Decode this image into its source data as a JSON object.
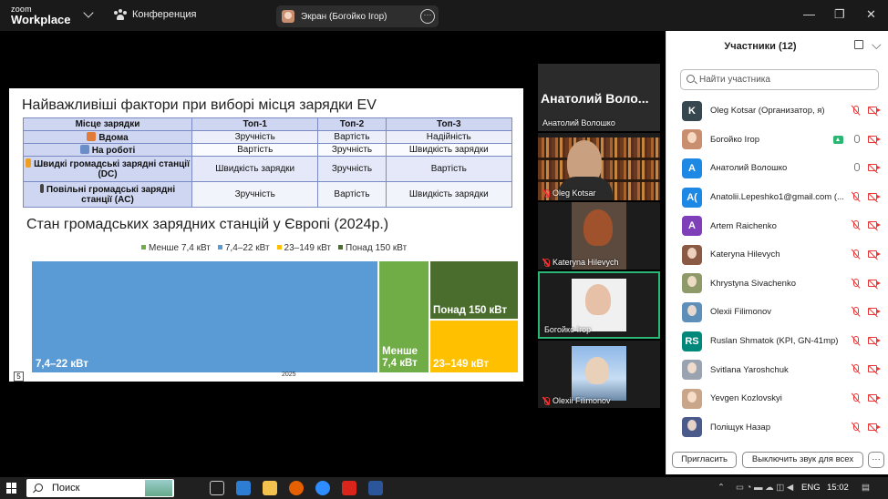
{
  "topbar": {
    "logo_line1": "zoom",
    "logo_line2": "Workplace",
    "conference_label": "Конференция",
    "share_label": "Экран (Богойко Ігор)",
    "win_min": "—",
    "win_max": "❐",
    "win_close": "✕"
  },
  "slide": {
    "title": "Найважливіші фактори при виборі місця зарядки EV",
    "table": {
      "headers": [
        "Місце зарядки",
        "Топ-1",
        "Топ-2",
        "Топ-3"
      ],
      "rows": [
        {
          "place": "Вдома",
          "top1": "Зручність",
          "top2": "Вартість",
          "top3": "Надійність"
        },
        {
          "place": "На роботі",
          "top1": "Вартість",
          "top2": "Зручність",
          "top3": "Швидкість зарядки"
        },
        {
          "place": "Швидкі громадські зарядні станції (DC)",
          "top1": "Швидкість зарядки",
          "top2": "Зручність",
          "top3": "Вартість"
        },
        {
          "place": "Повільні громадські зарядні станції (AC)",
          "top1": "Зручність",
          "top2": "Вартість",
          "top3": "Швидкість зарядки"
        }
      ]
    },
    "subtitle": "Стан громадських зарядних станцій у Європі (2024р.)",
    "slide_number": "5",
    "footer_year": "2025"
  },
  "chart_data": {
    "type": "treemap",
    "title": "Стан громадських зарядних станцій у Європі (2024р.)",
    "legend": [
      "Менше 7,4 кВт",
      "7,4–22 кВт",
      "23–149 кВт",
      "Понад 150 кВт"
    ],
    "legend_position": "top",
    "items": [
      {
        "label": "7,4–22 кВт",
        "share": 0.715,
        "color": "#5b9bd5"
      },
      {
        "label": "Менше 7,4 кВт",
        "share": 0.105,
        "color": "#70ad47"
      },
      {
        "label": "Понад 150 кВт",
        "share": 0.096,
        "color": "#4a6d2e"
      },
      {
        "label": "23–149 кВт",
        "share": 0.084,
        "color": "#ffc000"
      }
    ],
    "labels_shown": [
      "7,4–22 кВт",
      "Менше\n7,4 кВт",
      "Понад 150 кВт",
      "23–149 кВт"
    ]
  },
  "tiles": {
    "big_name": "Анатолий Воло...",
    "tile1_name": "Анатолий Волошко",
    "tile2_name": "Oleg Kotsar",
    "tile3_name": "Kateryna Hilevych",
    "tile4_name": "Богойко Ігор",
    "tile5_name": "Olexii Filimonov"
  },
  "panel": {
    "title": "Участники (12)",
    "search_placeholder": "Найти участника",
    "participants": [
      {
        "initials": "K",
        "name": "Oleg Kotsar (Организатор, я)",
        "color": "#37474f",
        "mic": "off",
        "video": "off"
      },
      {
        "initials": "",
        "name": "Богойко Ігор",
        "color": "#c98e6f",
        "mic": "on",
        "video": "off",
        "sharing": true
      },
      {
        "initials": "A",
        "name": "Анатолий Волошко",
        "color": "#1e88e5",
        "mic": "on",
        "video": "off"
      },
      {
        "initials": "A(",
        "name": "Anatolii.Lepeshko1@gmail.com (...",
        "color": "#1e88e5",
        "mic": "off",
        "video": "off"
      },
      {
        "initials": "A",
        "name": "Artem Raichenko",
        "color": "#7e3fb8",
        "mic": "off",
        "video": "off"
      },
      {
        "initials": "",
        "name": "Kateryna Hilevych",
        "color": "#8a5a44",
        "mic": "off",
        "video": "off"
      },
      {
        "initials": "",
        "name": "Khrystyna Sivachenko",
        "color": "#8f9a6a",
        "mic": "off",
        "video": "off"
      },
      {
        "initials": "",
        "name": "Olexii Filimonov",
        "color": "#5e8fb8",
        "mic": "off",
        "video": "off"
      },
      {
        "initials": "RS",
        "name": "Ruslan Shmatok (KPI, GN-41mp)",
        "color": "#00897b",
        "mic": "off",
        "video": "off"
      },
      {
        "initials": "",
        "name": "Svitlana Yaroshchuk",
        "color": "#9aa4b0",
        "mic": "off",
        "video": "off"
      },
      {
        "initials": "",
        "name": "Yevgen Kozlovskyi",
        "color": "#c9a68a",
        "mic": "off",
        "video": "off"
      },
      {
        "initials": "",
        "name": "Поліщук Назар",
        "color": "#4a5a8a",
        "mic": "off",
        "video": "off"
      }
    ],
    "invite_label": "Пригласить",
    "mute_all_label": "Выключить звук для всех",
    "more_label": "···"
  },
  "taskbar": {
    "search_label": "Поиск",
    "lang": "ENG",
    "time": "15:02"
  }
}
